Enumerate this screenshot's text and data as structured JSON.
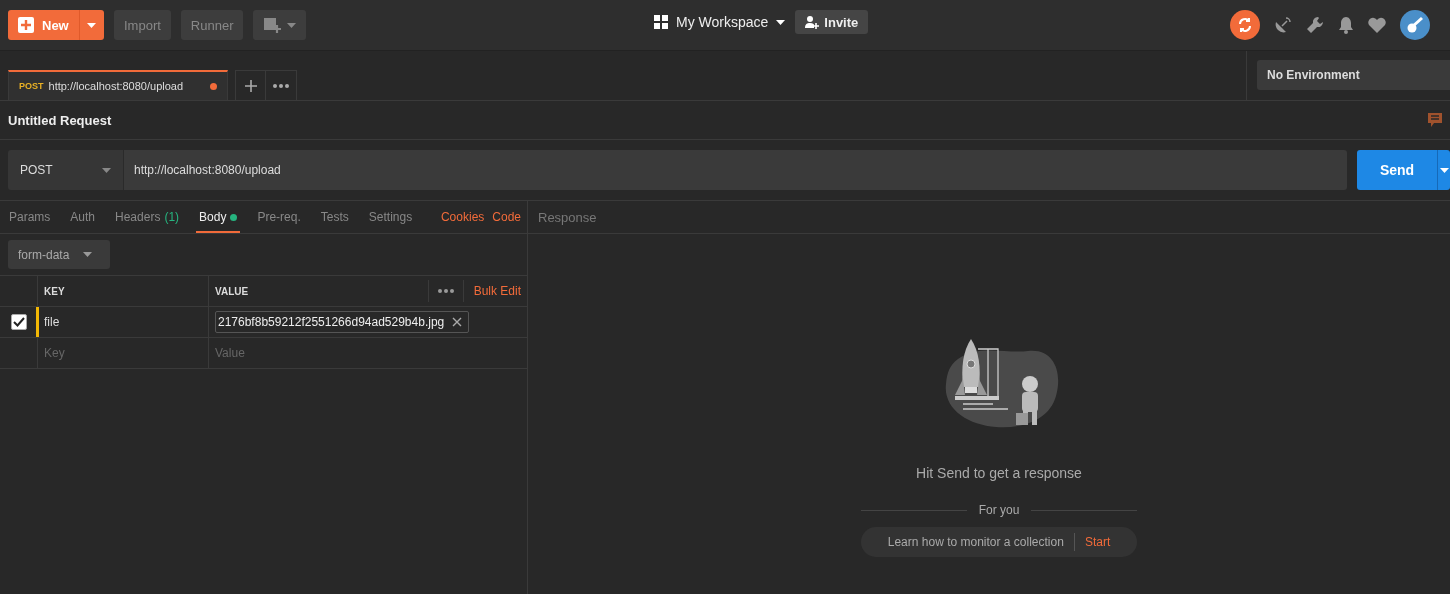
{
  "toolbar": {
    "new_button": "New",
    "buttons": [
      "Import",
      "Runner"
    ],
    "workspace": "My Workspace",
    "invite": "Invite"
  },
  "request_tabs": [
    {
      "method": "POST",
      "url": "http://localhost:8080/upload",
      "unsaved": true,
      "selected": true
    }
  ],
  "environment": "No Environment",
  "request_name": "Untitled Request",
  "request": {
    "method": "POST",
    "url": "http://localhost:8080/upload",
    "send": "Send"
  },
  "body_tabs": [
    {
      "label": "Params",
      "selected": false
    },
    {
      "label": "Auth",
      "selected": false
    },
    {
      "label": "Headers",
      "count": "(1)",
      "selected": false
    },
    {
      "label": "Body",
      "has_content": true,
      "selected": true
    },
    {
      "label": "Pre-req.",
      "selected": false
    },
    {
      "label": "Tests",
      "selected": false
    },
    {
      "label": "Settings",
      "selected": false
    }
  ],
  "body_links": [
    "Cookies",
    "Code"
  ],
  "body_type": "form-data",
  "form_table": {
    "columns": [
      "KEY",
      "VALUE"
    ],
    "bulk_edit": "Bulk Edit",
    "rows": [
      {
        "checked": true,
        "focused": true,
        "key": "file",
        "value": "2176bf8b59212f2551266d94ad529b4b.jpg"
      }
    ],
    "new_row": {
      "key_placeholder": "Key",
      "value_placeholder": "Value"
    }
  },
  "response": {
    "title": "Response",
    "empty_message": "Hit Send to get a response",
    "section": "For you",
    "tip": "Learn how to monitor a collection",
    "tip_action": "Start"
  }
}
